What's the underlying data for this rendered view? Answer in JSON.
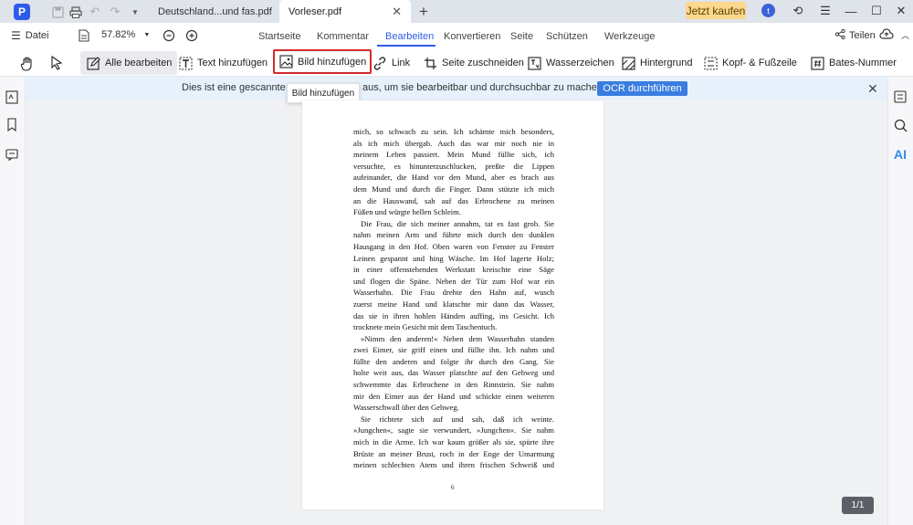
{
  "titlebar": {
    "tabs": [
      {
        "label": "Deutschland...und fas.pdf"
      },
      {
        "label": "Vorleser.pdf"
      }
    ],
    "buy_label": "Jetzt kaufen",
    "avatar_letter": "t"
  },
  "menubar": {
    "file_label": "Datei",
    "zoom": "57.82%",
    "tabs": [
      "Startseite",
      "Kommentar",
      "Bearbeiten",
      "Konvertieren",
      "Seite",
      "Schützen",
      "Werkzeuge"
    ],
    "active_tab": "Bearbeiten",
    "share_label": "Teilen"
  },
  "toolbar": {
    "tools": [
      "Alle bearbeiten",
      "Text hinzufügen",
      "Bild hinzufügen",
      "Link",
      "Seite zuschneiden",
      "Wasserzeichen",
      "Hintergrund",
      "Kopf- & Fußzeile",
      "Bates-Nummer"
    ]
  },
  "tooltip": "Bild hinzufügen",
  "notice": {
    "text_before": "Dies ist eine gescannte PD",
    "text_after": "aus, um sie bearbeitbar und durchsuchbar zu machen.",
    "ocr_label": "OCR durchführen"
  },
  "document": {
    "lines": [
      "mich, so schwach zu sein. Ich schämte mich besonders,",
      "als ich mich übergab. Auch das war mir noch nie in",
      "meinem Leben passiert. Mein Mund füllte sich, ich",
      "versuchte, es hinunterzuschlucken, preßte die Lippen",
      "aufeinander, die Hand vor den Mund, aber es brach aus",
      "dem Mund und durch die Finger. Dann stützte ich mich",
      "an die Hauswand, sah auf das Erbrochene zu meinen",
      "Füßen und würgte hellen Schleim.",
      "    Die Frau, die sich meiner annahm, tat es fast grob. Sie",
      "nahm meinen Arm und führte mich durch den dunklen",
      "Hausgang in den Hof. Oben waren von Fenster zu Fenster",
      "Leinen gespannt und hing Wäsche. Im Hof lagerte Holz;",
      "in einer offenstehenden Werkstatt kreischte eine Säge",
      "und flogen die Späne. Neben der Tür zum Hof war ein",
      "Wasserhahn. Die Frau drehte den Hahn auf, wusch",
      "zuerst meine Hand und klatschte mir dann das Wasser,",
      "das sie in ihren hohlen Händen auffing, ins Gesicht. Ich",
      "trocknete mein Gesicht mit dem Taschentuch.",
      "    »Nimm den anderen!« Neben dem Wasserhahn standen",
      "zwei Eimer, sie griff einen und füllte ihn. Ich nahm und",
      "füllte den anderen und folgte ihr durch den Gang. Sie",
      "holte weit aus, das Wasser platschte auf den Gehweg und",
      "schwemmte das Erbrochene in den Rinnstein. Sie nahm",
      "mir den Eimer aus der Hand und schickte einen weiteren",
      "Wasserschwall über den Gehweg.",
      "    Sie richtete sich auf und sah, daß ich weinte.",
      "»Jungchen«, sagte sie verwundert, »Jungchen«. Sie nahm",
      "mich in die Arme. Ich war kaum größer als sie, spürte ihre",
      "Brüste an meiner Brust, roch in der Enge der Umarmung",
      "meinen schlechten Atem und ihren frischen Schweiß und"
    ],
    "page_number": "6"
  },
  "page_indicator": "1/1",
  "colors": {
    "accent": "#2f5bea",
    "buy_button": "#fbd88c",
    "ocr_button": "#3a7de0",
    "highlight_border": "#d32a2a"
  }
}
